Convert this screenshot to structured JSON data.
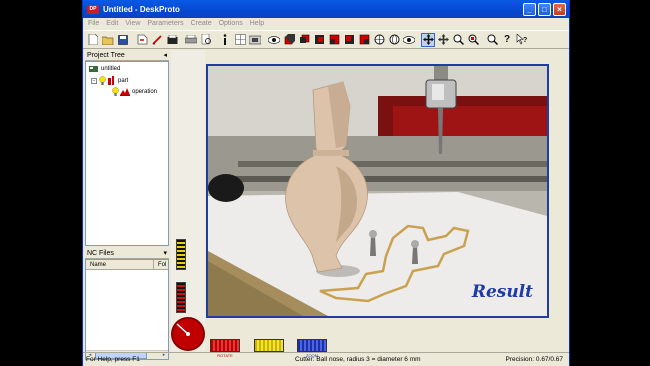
{
  "window": {
    "title": "Untitled - DeskProto",
    "app_icon_text": "DP",
    "buttons": {
      "minimize": "_",
      "maximize": "□",
      "close": "×"
    }
  },
  "menu": [
    "File",
    "Edit",
    "View",
    "Parameters",
    "Create",
    "Options",
    "Help"
  ],
  "toolbar": {
    "icons": [
      "new-icon",
      "open-icon",
      "save-icon",
      "import-icon",
      "edit-icon",
      "save-nc-icon",
      "print-icon",
      "print-preview-icon",
      "info-icon",
      "grid-icon",
      "layers-icon",
      "view-icon",
      "box-icon",
      "box2-icon",
      "box3-icon",
      "box4-icon",
      "box5-icon",
      "box6-icon",
      "sphere-icon",
      "sphere2-icon",
      "eye-icon",
      "move-icon",
      "pan-icon",
      "zoom-icon",
      "zoom-window-icon",
      "zoom-fit-icon",
      "help-icon",
      "whats-this-icon"
    ]
  },
  "project_tree": {
    "title": "Project Tree",
    "collapse": "◂",
    "items": [
      {
        "label": "untitled",
        "level": 0
      },
      {
        "label": "part",
        "level": 1
      },
      {
        "label": "operation",
        "level": 2
      }
    ]
  },
  "nc_files": {
    "title": "NC Files",
    "dropdown": "▾",
    "columns": [
      "Name",
      "Fol"
    ],
    "scroll_left": "◂",
    "scroll_right": "▸"
  },
  "viewport": {
    "result_text": "Result"
  },
  "view_buttons": {
    "rotate": "ROTATE",
    "mid": "",
    "zoom": "ZOOM"
  },
  "status": {
    "help": "For Help, press F1",
    "cutter": "Cutter: Ball nose, radius 3 = diameter 6 mm",
    "precision": "Precision: 0.67/0.67"
  },
  "colors": {
    "title_blue": "#0548d0",
    "viewport_border": "#203ea0",
    "result_text": "#1c3aa8"
  }
}
